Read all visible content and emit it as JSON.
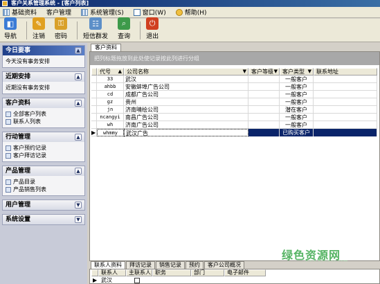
{
  "window": {
    "title": "客户关系管理系统 - [客户列表]"
  },
  "menu": [
    {
      "label": "基础资料",
      "icon": "grid-icon"
    },
    {
      "label": "客户管理",
      "icon": ""
    },
    {
      "label": "系统管理(S)",
      "icon": "grid-icon"
    },
    {
      "label": "窗口(W)",
      "icon": "window-icon"
    },
    {
      "label": "帮助(H)",
      "icon": "help-icon"
    }
  ],
  "toolbar": [
    {
      "label": "导航",
      "icon": "navigate-icon",
      "color": "#3a7bd5",
      "glyph": "◧"
    },
    {
      "label": "注销",
      "icon": "logout-icon",
      "color": "#e0a020",
      "glyph": "✎"
    },
    {
      "label": "密码",
      "icon": "key-icon",
      "color": "#d9a028",
      "glyph": "⚿"
    },
    {
      "label": "短信群发",
      "icon": "sms-icon",
      "color": "#5c8fc8",
      "glyph": "☷"
    },
    {
      "label": "查询",
      "icon": "search-icon",
      "color": "#3d9a4a",
      "glyph": "⌕"
    },
    {
      "label": "退出",
      "icon": "exit-icon",
      "color": "#d04020",
      "glyph": "⏻"
    }
  ],
  "sidebar": {
    "groups": [
      {
        "title": "今日要事",
        "active": true,
        "toggle": "▲",
        "items": [
          {
            "label": "今天没有事务安排",
            "icon": ""
          }
        ]
      },
      {
        "title": "近期安排",
        "active": false,
        "toggle": "▲",
        "items": [
          {
            "label": "近期没有事务安排",
            "icon": ""
          }
        ]
      },
      {
        "title": "客户资料",
        "active": false,
        "toggle": "▲",
        "items": [
          {
            "label": "全部客户列表",
            "icon": "customer-list-icon"
          },
          {
            "label": "联系人列表",
            "icon": "contacts-icon"
          }
        ]
      },
      {
        "title": "行动管理",
        "active": false,
        "toggle": "▲",
        "items": [
          {
            "label": "客户预约记录",
            "icon": "appointment-icon"
          },
          {
            "label": "客户拜访记录",
            "icon": "visit-icon"
          }
        ]
      },
      {
        "title": "产品管理",
        "active": false,
        "toggle": "▲",
        "items": [
          {
            "label": "产品目录",
            "icon": "product-icon"
          },
          {
            "label": "产品销售列表",
            "icon": "sales-icon"
          }
        ]
      },
      {
        "title": "用户管理",
        "active": false,
        "toggle": "▼",
        "items": []
      },
      {
        "title": "系统设置",
        "active": false,
        "toggle": "▼",
        "items": []
      }
    ]
  },
  "main": {
    "tab": "客户资料",
    "group_hint": "把列标题拖放到此处使记录按此列进行分组",
    "columns": [
      "代号",
      "公司名称",
      "客户等级",
      "客户类型",
      "联系地址"
    ],
    "rows": [
      {
        "code": "33",
        "name": "武汉",
        "level": "",
        "type": "一般客户",
        "addr": ""
      },
      {
        "code": "ahbb",
        "name": "安徽蚌埠广告公司",
        "level": "",
        "type": "一般客户",
        "addr": ""
      },
      {
        "code": "cd",
        "name": "成都广告公司",
        "level": "",
        "type": "一般客户",
        "addr": ""
      },
      {
        "code": "gz",
        "name": "贵州",
        "level": "",
        "type": "一般客户",
        "addr": ""
      },
      {
        "code": "jn",
        "name": "济南晴绘公司",
        "level": "",
        "type": "潜在客户",
        "addr": ""
      },
      {
        "code": "ncangyi",
        "name": "南昌广告公司",
        "level": "",
        "type": "一般客户",
        "addr": ""
      },
      {
        "code": "wh",
        "name": "济南广告公司",
        "level": "",
        "type": "一般客户",
        "addr": ""
      },
      {
        "code": "whmmy",
        "name": "武汉广告",
        "level": "",
        "type": "已购买客户",
        "addr": "",
        "selected": true
      }
    ]
  },
  "bottom_tabs": [
    "联系人资料",
    "拜访记录",
    "销售记录",
    "预约",
    "客户公司概况"
  ],
  "subgrid": {
    "columns": [
      "联系人",
      "主联系人",
      "职务",
      "部门",
      "电子邮件"
    ],
    "row": {
      "contact": "武汉"
    }
  },
  "watermark": {
    "big": "绿色资源网",
    "small": "www.downcc.com"
  }
}
